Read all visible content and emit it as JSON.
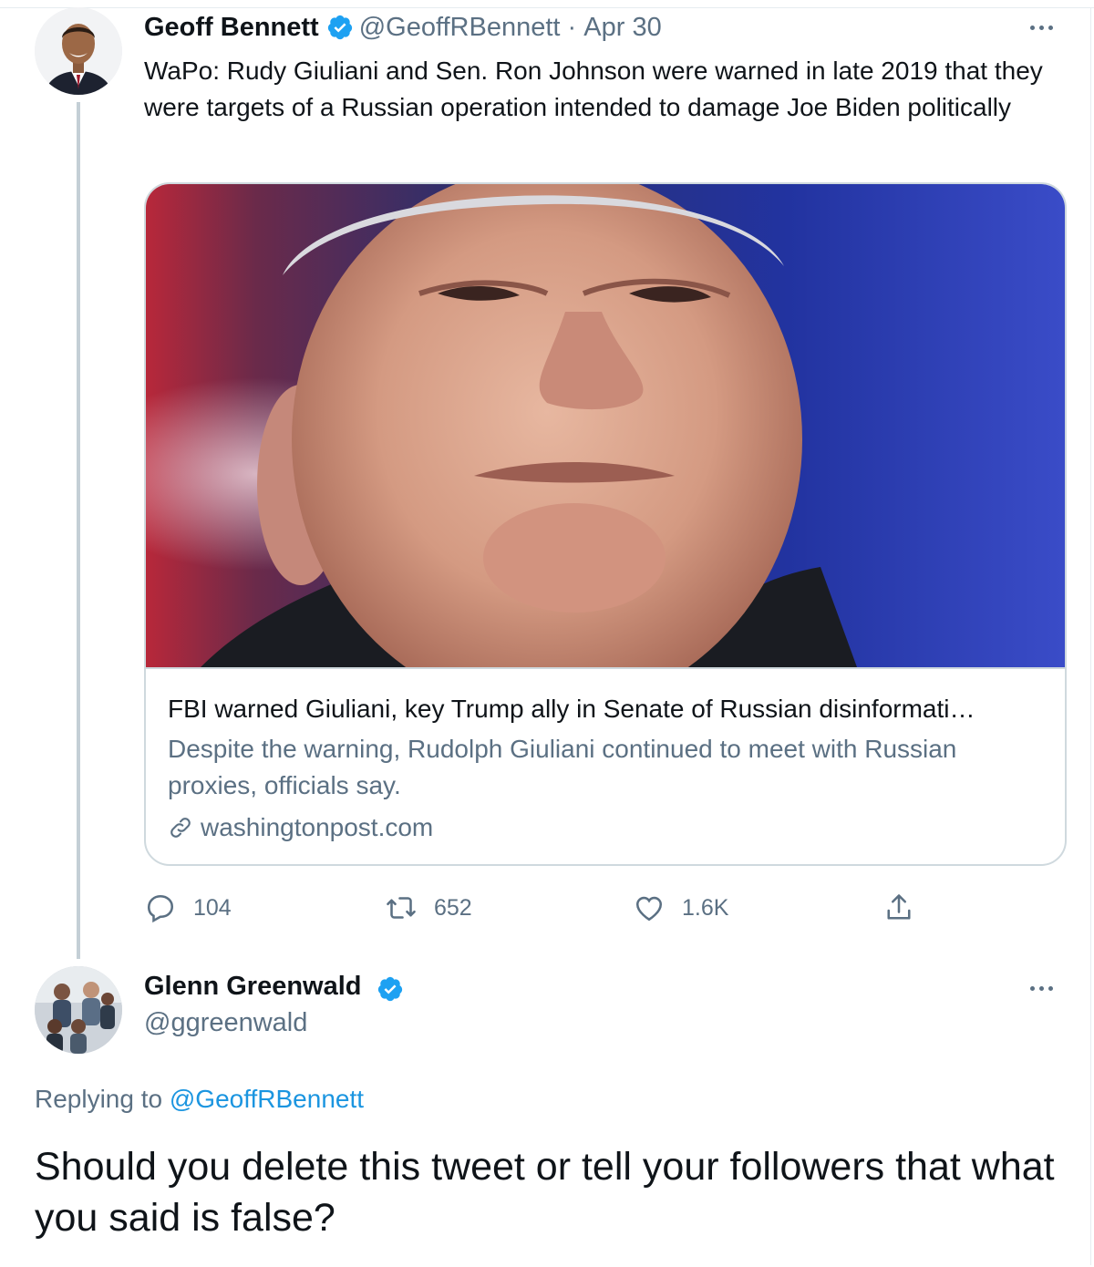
{
  "tweet": {
    "author_name": "Geoff Bennett",
    "author_handle": "@GeoffRBennett",
    "separator": "·",
    "date": "Apr 30",
    "text": "WaPo: Rudy Giuliani and Sen. Ron Johnson were warned in late 2019 that they were targets of a Russian operation intended to damage Joe Biden politically",
    "card": {
      "title": "FBI warned Giuliani, key Trump ally in Senate of Russian disinformati…",
      "description": "Despite the warning, Rudolph Giuliani continued to meet with Russian proxies, officials say.",
      "domain": "washingtonpost.com",
      "image_icon": "news-photo"
    },
    "stats": {
      "replies": "104",
      "retweets": "652",
      "likes": "1.6K"
    }
  },
  "reply": {
    "author_name": "Glenn Greenwald",
    "author_handle": "@ggreenwald",
    "replying_to_prefix": "Replying to",
    "replying_to_handle": "@GeoffRBennett",
    "text": "Should you delete this tweet or tell your followers that what you said is false?"
  },
  "colors": {
    "verified": "#1da1f2",
    "link": "#1b95e0",
    "muted": "#5b7083",
    "border": "#cfd9de"
  },
  "icons": [
    "verified-badge-icon",
    "more-icon",
    "link-icon",
    "reply-icon",
    "retweet-icon",
    "like-icon",
    "share-icon"
  ]
}
